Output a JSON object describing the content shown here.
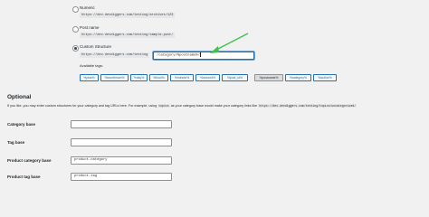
{
  "common_settings": {
    "options": [
      {
        "label": "Numeric",
        "example": "https://dev.devdiggers.com/testing/archives/123",
        "checked": false
      },
      {
        "label": "Post name",
        "example": "https://dev.devdiggers.com/testing/sample-post/",
        "checked": false
      },
      {
        "label": "Custom Structure",
        "example": "https://dev.devdiggers.com/testing",
        "checked": true
      }
    ],
    "custom_structure_prefix": "https://dev.devdiggers.com/testing",
    "custom_structure_value": "/category/%postname%/",
    "available_tags_label": "Available tags:",
    "tags": [
      "%year%",
      "%monthnum%",
      "%day%",
      "%hour%",
      "%minute%",
      "%second%",
      "%post_id%",
      "%postname%",
      "%category%",
      "%author%"
    ],
    "active_tag": "%postname%"
  },
  "arrow_color": "#3cc34c",
  "optional": {
    "heading": "Optional",
    "description_before": "If you like, you may enter custom structures for your category and tag URLs here. For example, using",
    "description_code": "topics",
    "description_middle": "as your category base would make your category links like",
    "description_example": "https://dev.devdiggers.com/testing/topics/uncategorized/"
  },
  "fields": [
    {
      "label": "Category base",
      "value": ""
    },
    {
      "label": "Tag base",
      "value": ""
    },
    {
      "label": "Product category base",
      "value": "product-category"
    },
    {
      "label": "Product tag base",
      "value": "product-tag"
    }
  ]
}
